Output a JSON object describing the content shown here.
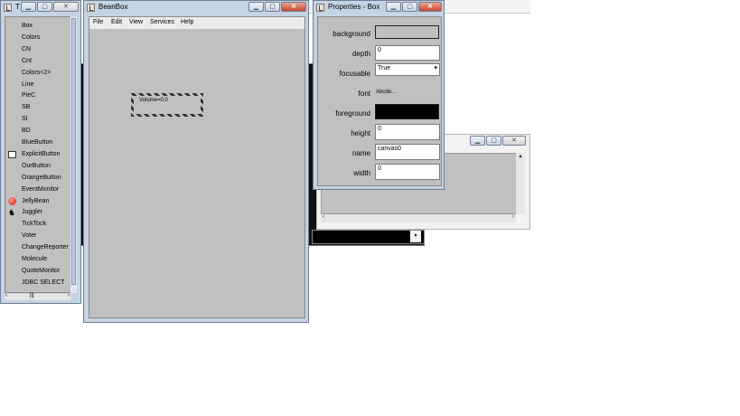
{
  "toolbox": {
    "title": "T",
    "items": [
      "Box",
      "Colors",
      "CN",
      "Cnt",
      "Colors<2>",
      "Line",
      "PieC",
      "SB",
      "SI",
      "BD",
      "BlueButton",
      "ExplicitButton",
      "OurButton",
      "OrangeButton",
      "EventMonitor",
      "JellyBean",
      "Juggler",
      "TickTock",
      "Voter",
      "ChangeReporter",
      "Molecule",
      "QuoteMonitor",
      "JDBC SELECT"
    ]
  },
  "beanbox": {
    "title": "BeanBox",
    "menu": [
      "File",
      "Edit",
      "View",
      "Services",
      "Help"
    ],
    "bean_label": "Volume=0.0"
  },
  "properties": {
    "title": "Properties - Box",
    "rows": [
      {
        "label": "background",
        "value": ""
      },
      {
        "label": "depth",
        "value": "0"
      },
      {
        "label": "focusable",
        "value": "True"
      },
      {
        "label": "font",
        "value": "Abcde..."
      },
      {
        "label": "foreground",
        "value": ""
      },
      {
        "label": "height",
        "value": "0"
      },
      {
        "label": "name",
        "value": "canvas0"
      },
      {
        "label": "width",
        "value": "0"
      }
    ]
  },
  "colors": {
    "accent": "#c5d3e3",
    "canvas": "#c0c0c0",
    "close": "#c9472c"
  }
}
